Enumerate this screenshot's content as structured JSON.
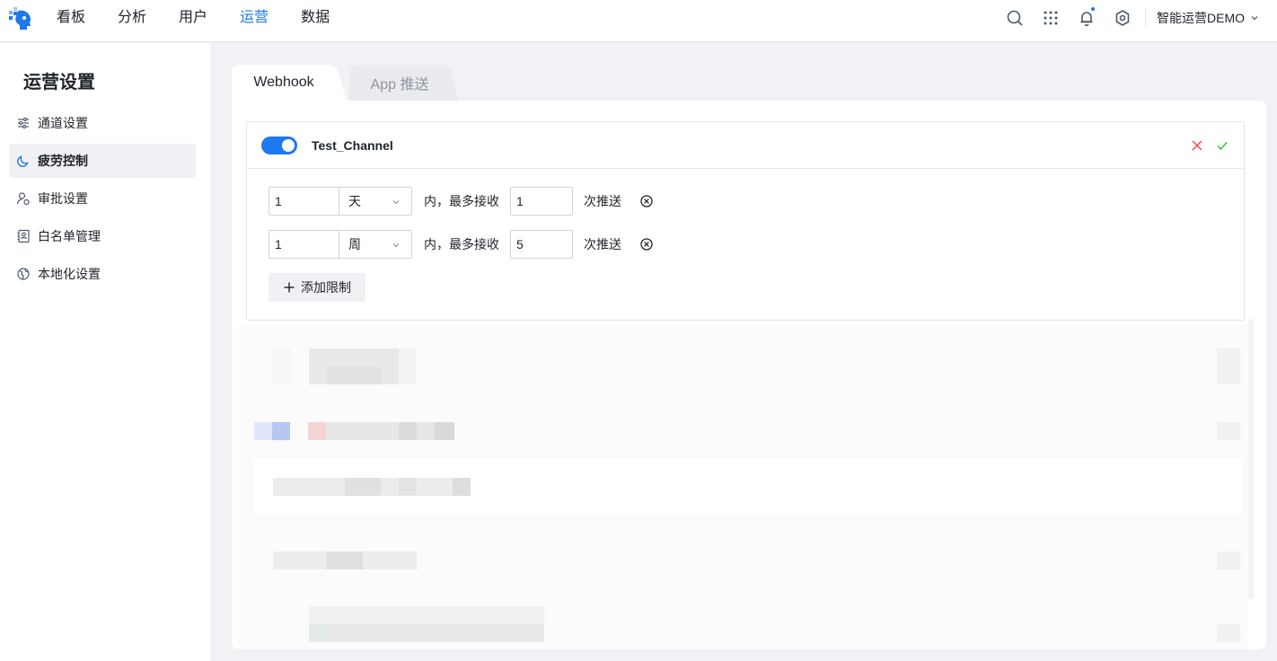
{
  "colors": {
    "accent": "#1e78f0",
    "danger": "#f54a45",
    "success": "#34c724"
  },
  "header": {
    "nav": [
      {
        "label": "看板"
      },
      {
        "label": "分析"
      },
      {
        "label": "用户"
      },
      {
        "label": "运营"
      },
      {
        "label": "数据"
      }
    ],
    "active_nav": "运营",
    "icons": [
      "search-icon",
      "apps-grid-icon",
      "bell-icon",
      "settings-icon"
    ],
    "user_menu_label": "智能运营DEMO"
  },
  "sidebar": {
    "title": "运营设置",
    "items": [
      {
        "label": "通道设置",
        "icon": "sliders-icon"
      },
      {
        "label": "疲劳控制",
        "icon": "moon-icon",
        "active": true
      },
      {
        "label": "审批设置",
        "icon": "user-check-icon"
      },
      {
        "label": "白名单管理",
        "icon": "contact-list-icon"
      },
      {
        "label": "本地化设置",
        "icon": "globe-icon"
      }
    ]
  },
  "tabs": [
    {
      "label": "Webhook",
      "active": true
    },
    {
      "label": "App 推送",
      "active": false
    }
  ],
  "channel": {
    "enabled": true,
    "name": "Test_Channel",
    "rules": [
      {
        "period": "1",
        "unit": "天",
        "middle_text": "内，最多接收",
        "count": "1",
        "suffix": "次推送"
      },
      {
        "period": "1",
        "unit": "周",
        "middle_text": "内，最多接收",
        "count": "5",
        "suffix": "次推送"
      }
    ],
    "add_button_label": "添加限制"
  }
}
